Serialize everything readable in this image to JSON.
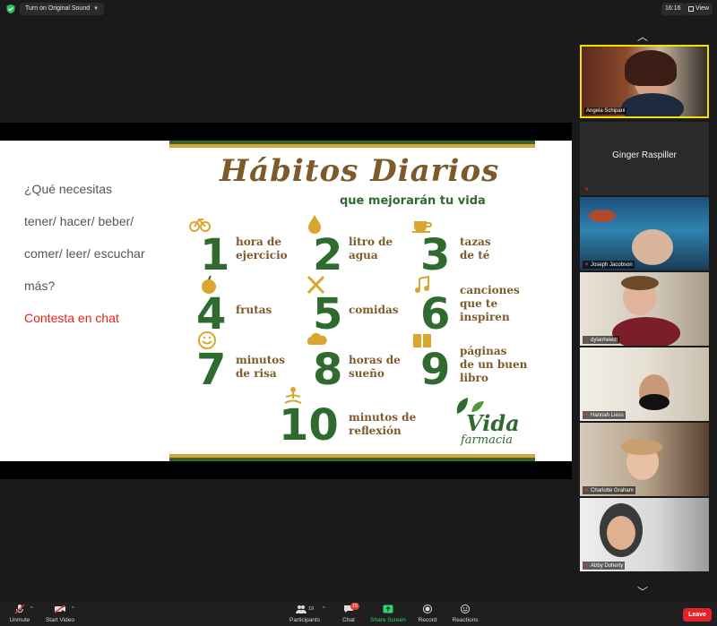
{
  "topbar": {
    "audio_label": "Turn on Original Sound",
    "time": "16:16",
    "view_label": "View"
  },
  "slide": {
    "question_lines": [
      "¿Qué necesitas",
      "tener/ hacer/ beber/",
      "comer/ leer/ escuchar",
      "más?"
    ],
    "prompt": "Contesta en chat",
    "poster": {
      "title": "Hábitos Diarios",
      "subtitle": "que mejorarán tu vida",
      "habits": [
        {
          "num": "1",
          "label": "hora de\nejercicio",
          "icon": "bicycle-icon"
        },
        {
          "num": "2",
          "label": "litro de\nagua",
          "icon": "water-drop-icon"
        },
        {
          "num": "3",
          "label": "tazas\nde té",
          "icon": "teacup-icon"
        },
        {
          "num": "4",
          "label": "frutas",
          "icon": "apple-icon"
        },
        {
          "num": "5",
          "label": "comidas",
          "icon": "fork-knife-icon"
        },
        {
          "num": "6",
          "label": "canciones\nque te\ninspiren",
          "icon": "music-note-icon"
        },
        {
          "num": "7",
          "label": "minutos\nde risa",
          "icon": "smiley-icon"
        },
        {
          "num": "8",
          "label": "horas de\nsueño",
          "icon": "sleep-cloud-icon"
        },
        {
          "num": "9",
          "label": "páginas\nde un buen\nlibro",
          "icon": "book-icon"
        },
        {
          "num": "10",
          "label": "minutos de\nreflexión",
          "icon": "meditation-icon"
        }
      ],
      "logo_main": "Vida",
      "logo_sub": "farmacia"
    }
  },
  "gallery": {
    "participants": [
      {
        "name": "Angela Schipani",
        "active": true,
        "video": true
      },
      {
        "name": "Ginger Raspiller",
        "active": false,
        "video": false
      },
      {
        "name": "Joseph Jacobson",
        "active": false,
        "video": true
      },
      {
        "name": "dylanhewitt",
        "active": false,
        "video": true
      },
      {
        "name": "Hannah Liess",
        "active": false,
        "video": true
      },
      {
        "name": "Charlotte Graham",
        "active": false,
        "video": true
      },
      {
        "name": "Abby Doherty",
        "active": false,
        "video": true
      }
    ]
  },
  "toolbar": {
    "unmute": "Unmute",
    "start_video": "Start Video",
    "participants": "Participants",
    "participants_count": "19",
    "chat": "Chat",
    "chat_badge": "15",
    "share_screen": "Share Screen",
    "record": "Record",
    "reactions": "Reactions",
    "leave": "Leave"
  },
  "colors": {
    "accent_green": "#2ed573",
    "leave_red": "#e0242a",
    "active_speaker": "#f2e200",
    "poster_green": "#2f6b2e",
    "poster_brown": "#7d5a2a"
  }
}
